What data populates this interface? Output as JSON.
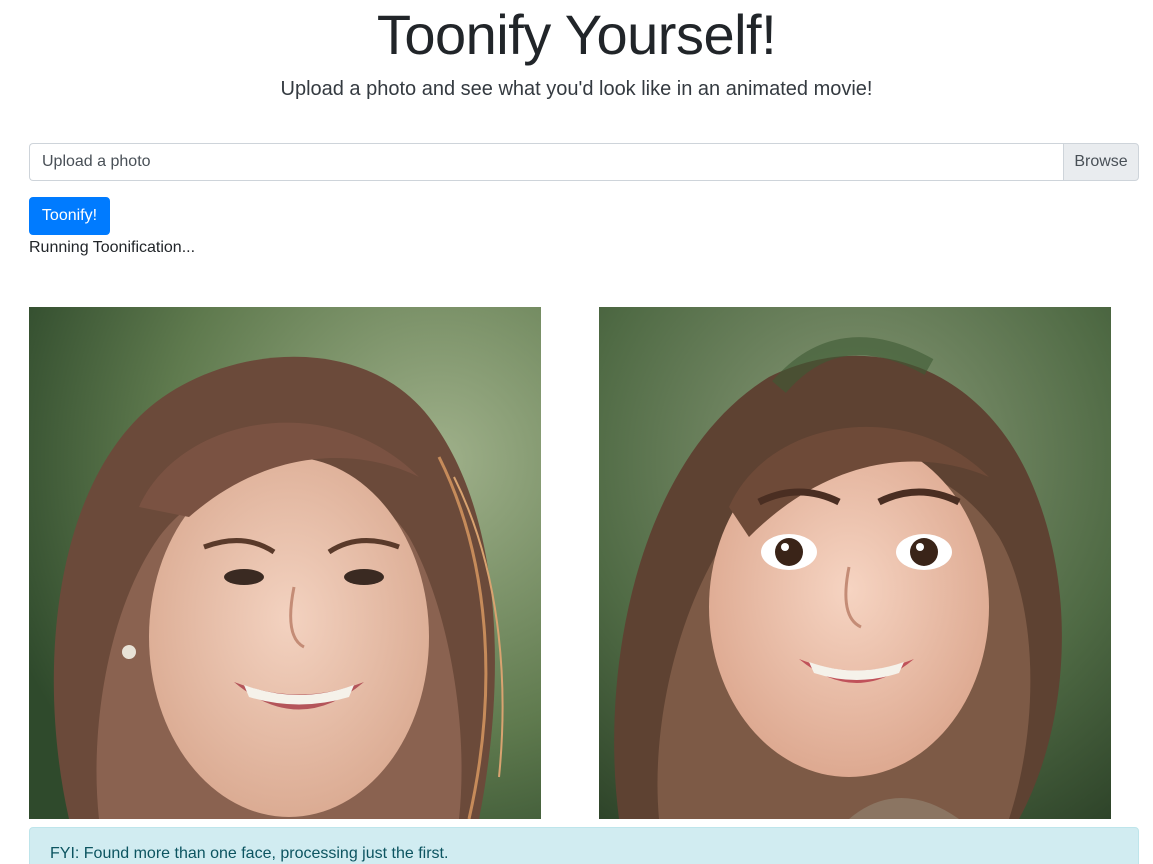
{
  "header": {
    "title": "Toonify Yourself!",
    "subtitle": "Upload a photo and see what you'd look like in an animated movie!"
  },
  "upload": {
    "placeholder": "Upload a photo",
    "browse_label": "Browse"
  },
  "actions": {
    "toonify_label": "Toonify!"
  },
  "status_text": "Running Toonification...",
  "images": {
    "original_alt": "original-photo",
    "toonified_alt": "toonified-photo"
  },
  "alert": {
    "message": "FYI: Found more than one face, processing just the first."
  },
  "colors": {
    "primary": "#007bff",
    "alert_bg": "#d1ecf1",
    "alert_text": "#0c5460"
  }
}
